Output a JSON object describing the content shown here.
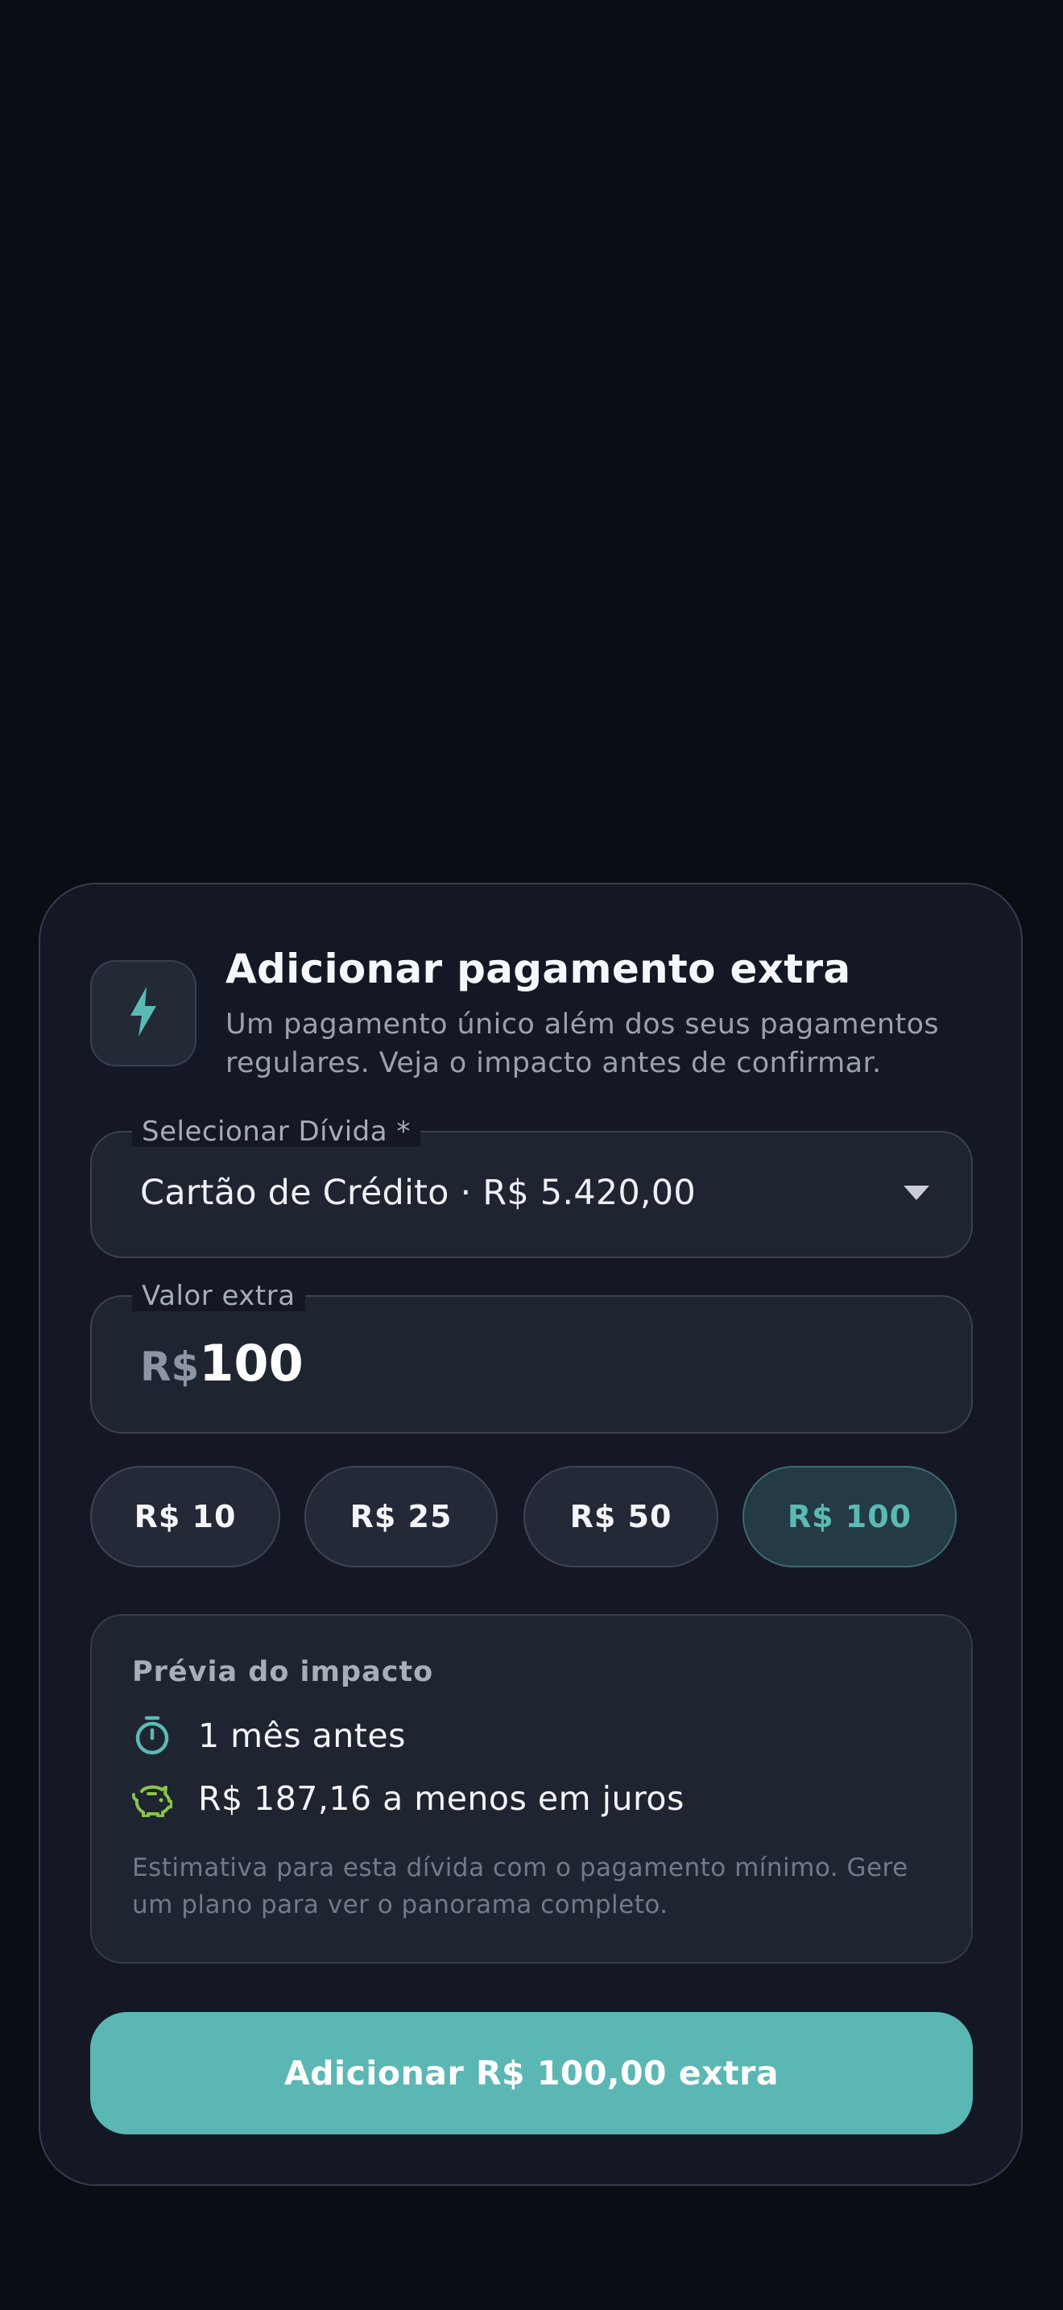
{
  "dialog": {
    "icon": "lightning-bolt-icon",
    "title": "Adicionar pagamento extra",
    "subtitle": "Um pagamento único além dos seus pagamentos regulares. Veja o impacto antes de confirmar."
  },
  "debt_select": {
    "label": "Selecionar Dívida *",
    "value": "Cartão de Crédito · R$ 5.420,00",
    "icon": "chevron-down-icon"
  },
  "extra_amount": {
    "label": "Valor extra",
    "prefix": "R$",
    "value": "100"
  },
  "quick_amounts": [
    {
      "label": "R$ 10",
      "selected": false
    },
    {
      "label": "R$ 25",
      "selected": false
    },
    {
      "label": "R$ 50",
      "selected": false
    },
    {
      "label": "R$ 100",
      "selected": true
    }
  ],
  "impact": {
    "title": "Prévia do impacto",
    "rows": [
      {
        "icon": "timer-icon",
        "text": "1 mês antes"
      },
      {
        "icon": "piggy-bank-icon",
        "text": "R$ 187,16 a menos em juros"
      }
    ],
    "note": "Estimativa para esta dívida com o pagamento mínimo. Gere um plano para ver o panorama completo."
  },
  "cta": {
    "label": "Adicionar R$ 100,00 extra"
  },
  "colors": {
    "background": "#0b0d15",
    "sheet": "#141824",
    "accent": "#5bb7b3",
    "timer_icon": "#5bbab4",
    "piggy_icon": "#8bc34a"
  }
}
